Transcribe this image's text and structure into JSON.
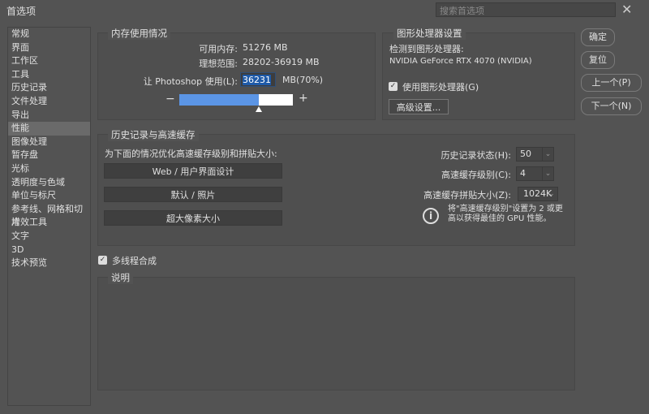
{
  "window": {
    "title": "首选项",
    "search_placeholder": "搜索首选项",
    "close": "✕"
  },
  "sidebar": {
    "items": [
      "常规",
      "界面",
      "工作区",
      "工具",
      "历史记录",
      "文件处理",
      "导出",
      "性能",
      "图像处理",
      "暂存盘",
      "光标",
      "透明度与色域",
      "单位与标尺",
      "参考线、网格和切片",
      "增效工具",
      "文字",
      "3D",
      "技术预览"
    ],
    "selected": 7
  },
  "memory": {
    "title": "内存使用情况",
    "available_label": "可用内存:",
    "available_value": "51276 MB",
    "ideal_label": "理想范围:",
    "ideal_value": "28202-36919 MB",
    "use_label": "让 Photoshop 使用(L):",
    "use_value": "36231",
    "use_unit": "MB(70%)",
    "minus": "−",
    "plus": "+",
    "slider_percent": 70
  },
  "gpu": {
    "title": "图形处理器设置",
    "detected_label": "检测到图形处理器:",
    "gpu_name": "NVIDIA GeForce RTX 4070 (NVIDIA)",
    "use_gpu_label": "使用图形处理器(G)",
    "use_gpu_checked": true,
    "advanced_button": "高级设置..."
  },
  "history": {
    "title": "历史记录与高速缓存",
    "optimize_label": "为下面的情况优化高速缓存级别和拼贴大小:",
    "presets": [
      "Web / 用户界面设计",
      "默认 / 照片",
      "超大像素大小"
    ],
    "states_label": "历史记录状态(H):",
    "states_value": "50",
    "cache_levels_label": "高速缓存级别(C):",
    "cache_levels_value": "4",
    "tile_size_label": "高速缓存拼贴大小(Z):",
    "tile_size_value": "1024K",
    "info_text": "将\"高速缓存级别\"设置为 2 或更高以获得最佳的 GPU 性能。"
  },
  "multithread": {
    "label": "多线程合成",
    "checked": true
  },
  "description": {
    "title": "说明"
  },
  "buttons": {
    "ok": "确定",
    "reset": "复位",
    "prev": "上一个(P)",
    "next": "下一个(N)"
  }
}
